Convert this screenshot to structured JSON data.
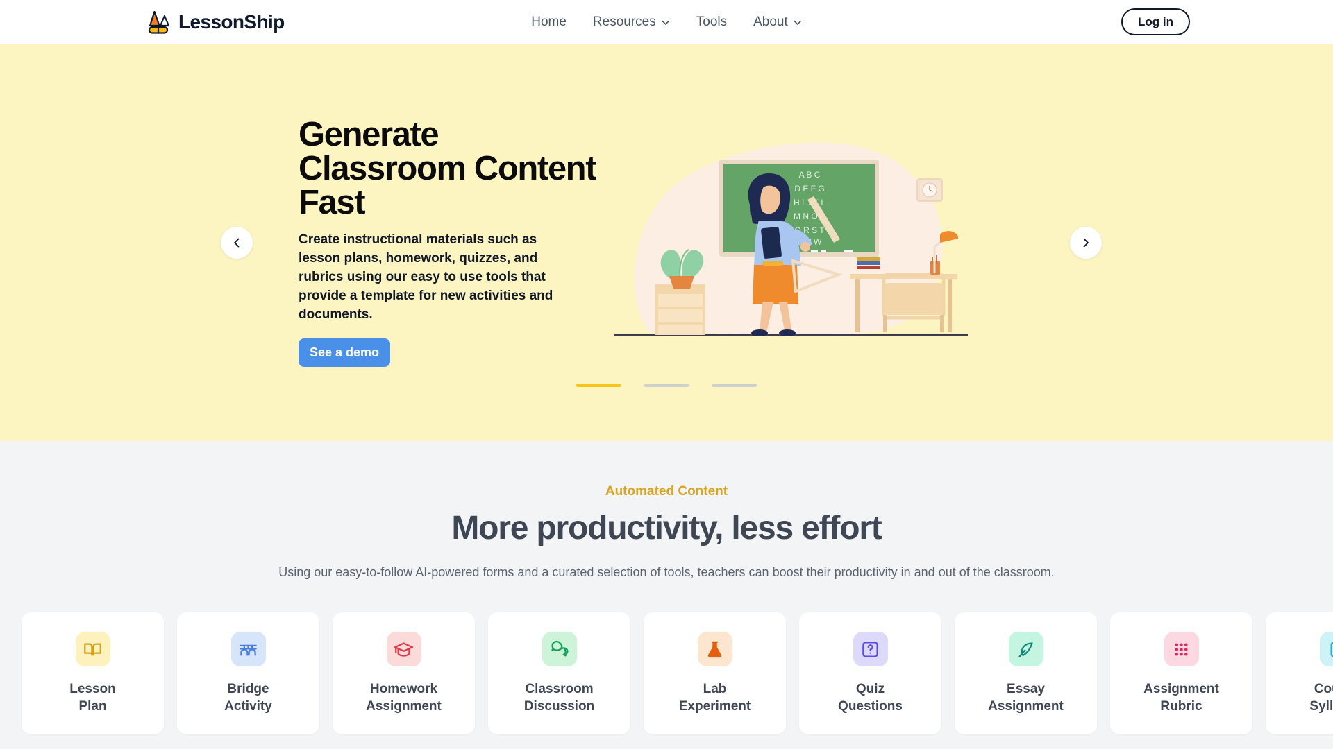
{
  "header": {
    "logo_text": "LessonShip",
    "logo_icon": "lessonship-logo-icon",
    "nav": [
      {
        "label": "Home",
        "has_caret": false
      },
      {
        "label": "Resources",
        "has_caret": true
      },
      {
        "label": "Tools",
        "has_caret": false
      },
      {
        "label": "About",
        "has_caret": true
      }
    ],
    "login_label": "Log in"
  },
  "hero": {
    "background": "#fcf5c2",
    "title": "Generate Classroom Content Fast",
    "description": "Create instructional materials such as lesson plans, homework, quizzes, and rubrics using our easy to use tools that provide a template for new activities and documents.",
    "cta_label": "See a demo",
    "cta_color": "#4a90e8",
    "prev_icon": "chevron-left-icon",
    "next_icon": "chevron-right-icon",
    "slides": 3,
    "active_slide": 1,
    "illustration": {
      "name": "teacher-at-chalkboard-illustration",
      "chalkboard_letters": "A B C D E F G H I J K L M N O P Q R S T U V W X Y Z"
    }
  },
  "features": {
    "eyebrow": "Automated Content",
    "eyebrow_color": "#d9a520",
    "title": "More productivity, less effort",
    "subtitle": "Using our easy-to-follow AI-powered forms and a curated selection of tools, teachers can boost their productivity in and out of the classroom.",
    "cards": [
      {
        "label": "Lesson\nPlan",
        "icon": "open-book-icon",
        "fg": "#d5a017",
        "bg": "#fdf2bd"
      },
      {
        "label": "Bridge\nActivity",
        "icon": "bridge-icon",
        "fg": "#4a7fe0",
        "bg": "#d7e5fb"
      },
      {
        "label": "Homework\nAssignment",
        "icon": "graduation-cap-icon",
        "fg": "#db3a49",
        "bg": "#fbdada"
      },
      {
        "label": "Classroom\nDiscussion",
        "icon": "chat-bubbles-icon",
        "fg": "#14a05a",
        "bg": "#cdf3d9"
      },
      {
        "label": "Lab\nExperiment",
        "icon": "flask-icon",
        "fg": "#e2600e",
        "bg": "#fde6cf"
      },
      {
        "label": "Quiz\nQuestions",
        "icon": "question-box-icon",
        "fg": "#5b4ae0",
        "bg": "#dcd9fb"
      },
      {
        "label": "Essay\nAssignment",
        "icon": "feather-quill-icon",
        "fg": "#11897c",
        "bg": "#c4f5e0"
      },
      {
        "label": "Assignment\nRubric",
        "icon": "grid-dots-icon",
        "fg": "#e0245e",
        "bg": "#fbd8e2"
      },
      {
        "label": "Course\nSyllabus",
        "icon": "clipboard-icon",
        "fg": "#1ab3d1",
        "bg": "#cdf2f8"
      }
    ]
  }
}
